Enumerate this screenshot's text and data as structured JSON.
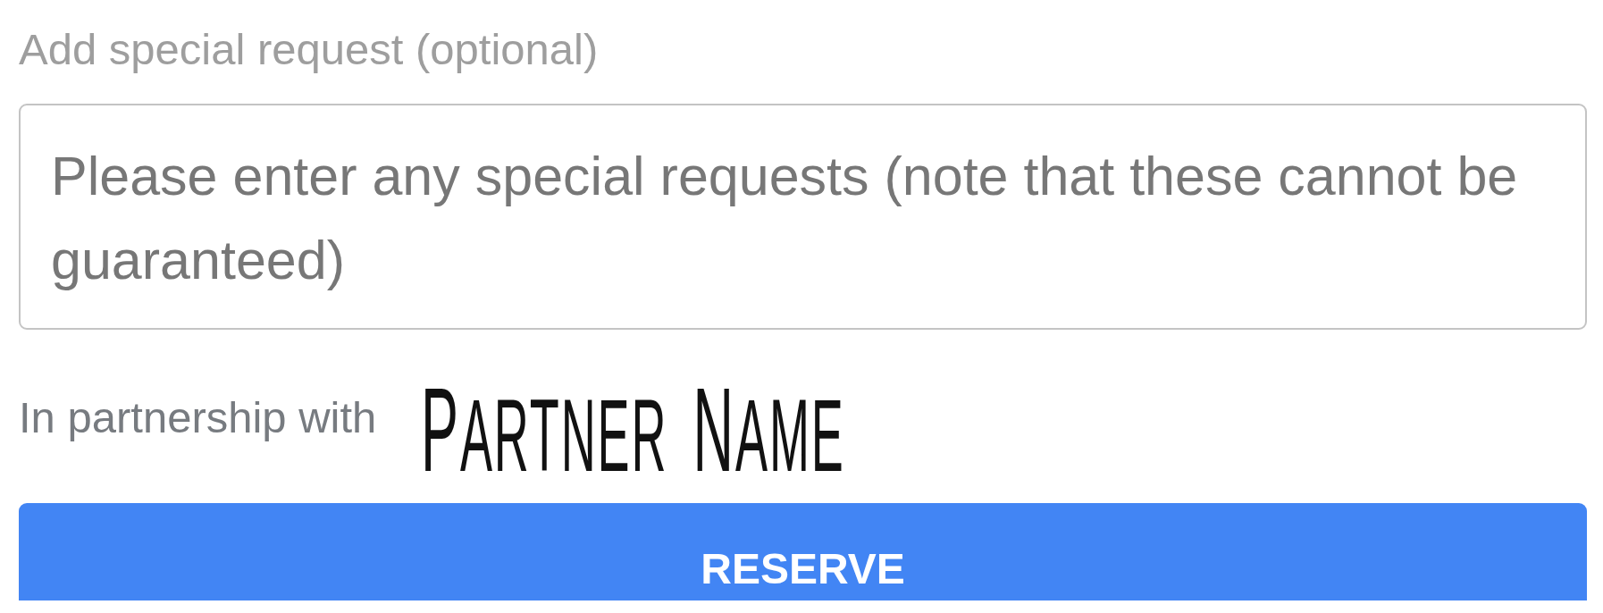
{
  "special_request": {
    "label": "Add special request (optional)",
    "placeholder": "Please enter any special requests (note that these cannot be guaranteed)"
  },
  "partnership": {
    "label": "In partnership with",
    "partner_logo": "PARTNER NAME"
  },
  "reserve_button": {
    "label": "RESERVE"
  }
}
